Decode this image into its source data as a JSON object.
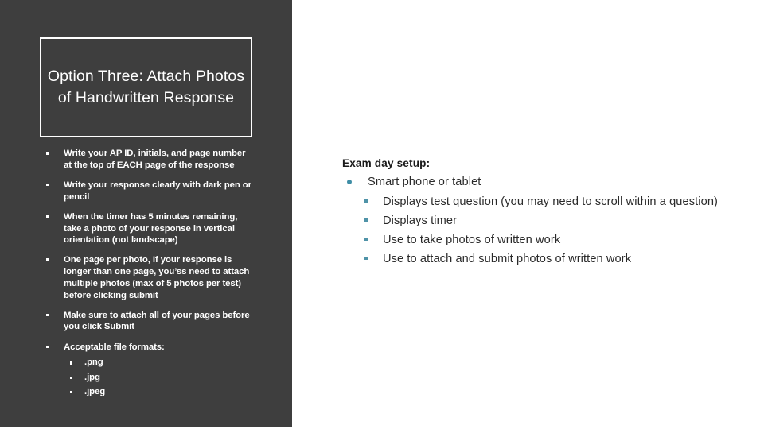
{
  "slide": {
    "title": "Option Three: Attach Photos of Handwritten Response",
    "colors": {
      "panel_background": "#3e3e3e",
      "slide_background": "#ffffff",
      "panel_text": "#ffffff",
      "title_border": "#ffffff",
      "right_text": "#2a2a2a",
      "right_bullet_accent": "#3f8ea6"
    }
  },
  "instructions": {
    "items": [
      {
        "text": "Write your AP ID, initials, and page number at the top of EACH page of the response",
        "bullet": "square-bullet"
      },
      {
        "text": "Write your response clearly with dark pen or pencil",
        "bullet": "square-bullet"
      },
      {
        "text": "When the timer has 5 minutes remaining, take a photo of your response in vertical orientation (not landscape)",
        "bullet": "square-bullet"
      },
      {
        "text": "One page per photo, If your response is longer than one page, you’ss need to attach multiple photos (max of 5 photos per test) before clicking submit",
        "bullet": "square-bullet"
      },
      {
        "text": "Make sure to attach all of your pages before you click Submit",
        "bullet": "square-bullet"
      },
      {
        "text": "Acceptable file formats:",
        "bullet": "square-bullet",
        "subitems": [
          {
            "text": ".png",
            "bullet": "square-bullet"
          },
          {
            "text": ".jpg",
            "bullet": "square-bullet"
          },
          {
            "text": ".jpeg",
            "bullet": "square-bullet"
          }
        ]
      }
    ]
  },
  "exam_setup": {
    "heading": "Exam day setup:",
    "device": {
      "text": "Smart phone or tablet",
      "bullet": "round-bullet"
    },
    "capabilities": [
      {
        "text": "Displays test question (you may need to scroll within a question)",
        "bullet": "square-bullet"
      },
      {
        "text": "Displays timer",
        "bullet": "square-bullet"
      },
      {
        "text": "Use to take photos of written work",
        "bullet": "square-bullet"
      },
      {
        "text": "Use to attach and submit photos of written work",
        "bullet": "square-bullet"
      }
    ]
  }
}
